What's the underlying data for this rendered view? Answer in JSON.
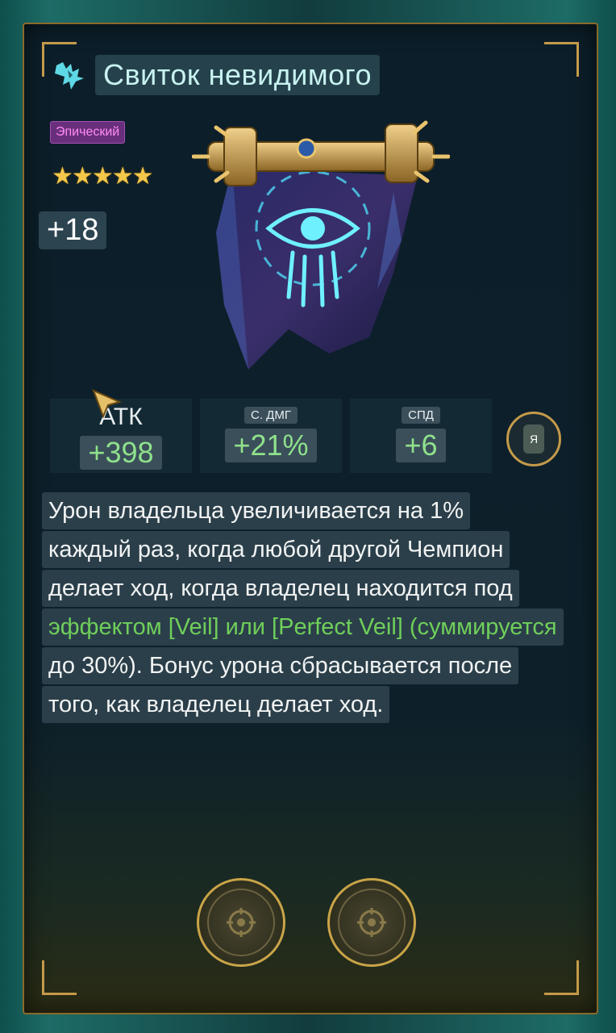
{
  "item": {
    "title": "Свиток невидимого",
    "rarity": "Эпический",
    "stars": 5,
    "level": "+18",
    "faction_icon": "faction-claw-icon",
    "art_icon": "banner-scroll-icon"
  },
  "stats": [
    {
      "label": "АТК",
      "value": "+398"
    },
    {
      "label": "С. ДМГ",
      "value": "+21%"
    },
    {
      "label": "СПД",
      "value": "+6"
    }
  ],
  "lock": {
    "label": "Я"
  },
  "description": {
    "line1": "Урон владельца увеличивается на 1%",
    "line2": "каждый раз, когда любой другой Чемпион",
    "line3": "делает ход, когда владелец находится под",
    "line4": "эффектом [Veil] или [Perfect Veil] (суммируется",
    "line5": "до 30%). Бонус урона сбрасывается после",
    "line6": "того, как владелец делает ход."
  },
  "colors": {
    "accent_gold": "#c49a4a",
    "stat_green": "#8fe18b",
    "rarity_purple": "#6a2f7c",
    "title_text": "#c8f2f0"
  },
  "buttons": [
    "target-icon",
    "target-icon"
  ]
}
